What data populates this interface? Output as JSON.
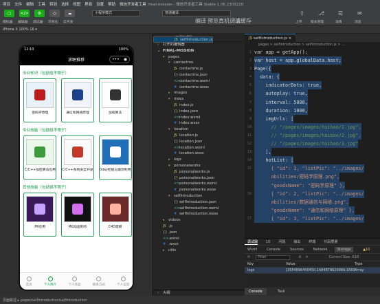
{
  "menubar": {
    "items": [
      "项目",
      "文件",
      "编辑",
      "工具",
      "转到",
      "选择",
      "视图",
      "界面",
      "设置",
      "帮助",
      "微信开发者工具"
    ],
    "title": "final-mission - 微信开发者工具 Stable 1.06.2303220"
  },
  "toolbar": {
    "left_labels": [
      "模拟器",
      "编辑器",
      "调试器",
      "可视化",
      "云开发"
    ],
    "mode_select": "小程序模式",
    "compile_select": "普通编译",
    "mid_labels": [
      "编译",
      "预览",
      "真机调试",
      "清缓存"
    ],
    "right_labels": [
      "上传",
      "版本管理",
      "详情",
      "消息"
    ]
  },
  "subbar": {
    "device": "iPhone X 100% 16 ▾"
  },
  "phone": {
    "time": "12:10",
    "battery": "100%",
    "nav_title": "求职推荐",
    "sections": [
      {
        "title": "专业知识（包括但不限于）",
        "cards": [
          {
            "caption": "密码学原理"
          },
          {
            "caption": "通信和网络原理"
          },
          {
            "caption": "加密算法"
          }
        ]
      },
      {
        "title": "专业技能（包括但不限于）",
        "cards": [
          {
            "caption": "C/C++加密算法应用"
          },
          {
            "caption": "C/C++系统安全开发"
          },
          {
            "caption": "0day挖掘与漏洞利用"
          }
        ]
      },
      {
        "title": "其他技能（包括但不限于）",
        "cards": [
          {
            "caption": "PR应用"
          },
          {
            "caption": "MG动画制作"
          },
          {
            "caption": "C4D建模"
          }
        ]
      }
    ],
    "tabs": [
      "首页",
      "个人简介",
      "个人作品",
      "联系方式",
      "个人信息"
    ]
  },
  "explorer": {
    "header": "资源管理器",
    "sections": [
      "打开的编辑器",
      "FINAL-MISSION"
    ],
    "tree": [
      {
        "label": "pages",
        "depth": 1,
        "type": "folder",
        "open": true
      },
      {
        "label": "contactme",
        "depth": 2,
        "type": "folder",
        "open": true
      },
      {
        "label": "contactme.js",
        "depth": 3,
        "type": "js"
      },
      {
        "label": "contactme.json",
        "depth": 3,
        "type": "json"
      },
      {
        "label": "contactme.wxml",
        "depth": 3,
        "type": "wxml"
      },
      {
        "label": "contactme.wxss",
        "depth": 3,
        "type": "wxss"
      },
      {
        "label": "images",
        "depth": 2,
        "type": "folder",
        "open": false
      },
      {
        "label": "index",
        "depth": 2,
        "type": "folder",
        "open": true
      },
      {
        "label": "index.js",
        "depth": 3,
        "type": "js"
      },
      {
        "label": "index.json",
        "depth": 3,
        "type": "json"
      },
      {
        "label": "index.wxml",
        "depth": 3,
        "type": "wxml"
      },
      {
        "label": "index.wxss",
        "depth": 3,
        "type": "wxss"
      },
      {
        "label": "location",
        "depth": 2,
        "type": "folder",
        "open": true
      },
      {
        "label": "location.js",
        "depth": 3,
        "type": "js"
      },
      {
        "label": "location.json",
        "depth": 3,
        "type": "json"
      },
      {
        "label": "location.wxml",
        "depth": 3,
        "type": "wxml"
      },
      {
        "label": "location.wxss",
        "depth": 3,
        "type": "wxss"
      },
      {
        "label": "logs",
        "depth": 2,
        "type": "folder",
        "open": false
      },
      {
        "label": "personalworks",
        "depth": 2,
        "type": "folder",
        "open": true
      },
      {
        "label": "personalworks.js",
        "depth": 3,
        "type": "js"
      },
      {
        "label": "personalworks.json",
        "depth": 3,
        "type": "json"
      },
      {
        "label": "personalworks.wxml",
        "depth": 3,
        "type": "wxml"
      },
      {
        "label": "personalworks.wxss",
        "depth": 3,
        "type": "wxss"
      },
      {
        "label": "selfIntroduction",
        "depth": 2,
        "type": "folder",
        "open": true
      },
      {
        "label": "selfIntroduction.js",
        "depth": 3,
        "type": "js",
        "selected": true
      },
      {
        "label": "selfIntroduction.json",
        "depth": 3,
        "type": "json"
      },
      {
        "label": "selfIntroduction.wxml",
        "depth": 3,
        "type": "wxml"
      },
      {
        "label": "selfIntroduction.wxss",
        "depth": 3,
        "type": "wxss"
      },
      {
        "label": "videos",
        "depth": 1,
        "type": "folder",
        "open": false
      },
      {
        "label": ".js",
        "depth": 1,
        "type": "js"
      },
      {
        "label": ".json",
        "depth": 1,
        "type": "json"
      },
      {
        "label": ".wxml",
        "depth": 1,
        "type": "wxml"
      },
      {
        "label": ".wxss",
        "depth": 1,
        "type": "wxss"
      },
      {
        "label": "utils",
        "depth": 1,
        "type": "folder",
        "open": false
      }
    ],
    "footer": "大纲"
  },
  "editor": {
    "tab": "selfIntroduction.js",
    "breadcrumb": "pages > selfIntroduction > selfIntroduction.js > ...",
    "lines": [
      {
        "n": "1",
        "t": "var app = getApp();"
      },
      {
        "n": "2",
        "t": "var host = app.globalData.host;"
      },
      {
        "n": "3",
        "t": "Page({"
      },
      {
        "n": "4",
        "t": "  data: {"
      },
      {
        "n": "5",
        "t": "    indicatorDots: true,"
      },
      {
        "n": "6",
        "t": "    autoplay: true,"
      },
      {
        "n": "7",
        "t": "    interval: 5000,"
      },
      {
        "n": "8",
        "t": "    duration: 1000,"
      },
      {
        "n": "9",
        "t": "    imgUrls: ["
      },
      {
        "n": "10",
        "t": "      // \"/pages/images/haibao/1.jpg\","
      },
      {
        "n": "11",
        "t": "      // \"/pages/images/haibao/2.jpg\","
      },
      {
        "n": "12",
        "t": "      // \"/pages/images/haibao/3.jpg\""
      },
      {
        "n": "13",
        "t": "    ],"
      },
      {
        "n": "14",
        "t": "    hotList: ["
      },
      {
        "n": "15",
        "t": "      { \"id\": 1, \"listPic\": \"../images/"
      },
      {
        "n": "",
        "t": "      abilities/密码学原理.png\","
      },
      {
        "n": "",
        "t": "      \"goodsName\": \"密码学原理\" },"
      },
      {
        "n": "16",
        "t": "      { \"id\": 2, \"listPic\": \"../images/"
      },
      {
        "n": "",
        "t": "      abilities/数据通信与网络.png\","
      },
      {
        "n": "",
        "t": "      \"goodsName\": \"通信和网络原理\" },"
      },
      {
        "n": "17",
        "t": "      { \"id\": 3, \"listPic\": \"../images/"
      }
    ]
  },
  "devtools": {
    "tabs": [
      "调试器",
      "10",
      "问题",
      "输出",
      "终端",
      "代码质量"
    ],
    "sub_tabs": [
      "Wxml",
      "Console",
      "Sources",
      "Network",
      "Storage"
    ],
    "warn": "▲10",
    "filter_label": "Filter",
    "current_size": "Current Size: 61B",
    "columns": [
      "Key",
      "Value",
      "Type"
    ],
    "rows": [
      {
        "key": "logs",
        "value": "[1684896400450,1684878620989,1683...",
        "type": "Array"
      }
    ]
  },
  "console": {
    "tabs": [
      "Console",
      "Task"
    ]
  },
  "status": {
    "path": "页面路径 ▸ pages/selfIntroduction/selfIntroduction"
  }
}
